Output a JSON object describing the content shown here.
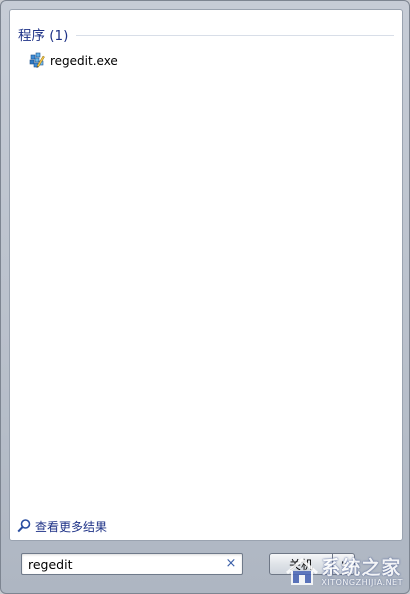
{
  "results": {
    "group_title": "程序 (1)",
    "items": [
      {
        "label": "regedit.exe",
        "icon": "registry-editor-icon"
      }
    ],
    "see_more_label": "查看更多结果"
  },
  "search": {
    "value": "regedit",
    "clear_glyph": "×"
  },
  "shutdown": {
    "label": "关机"
  },
  "watermark": {
    "name": "系统之家",
    "url": "XITONGZHIJIA.NET"
  },
  "colors": {
    "group_title": "#1e3287",
    "link": "#1e3287",
    "frame": "#b9c0cb"
  }
}
